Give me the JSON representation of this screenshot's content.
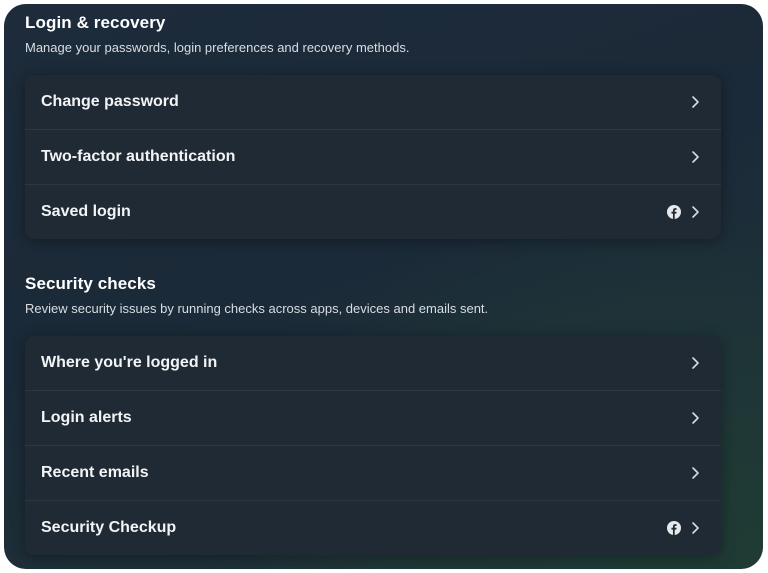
{
  "login_recovery": {
    "title": "Login & recovery",
    "description": "Manage your passwords, login preferences and recovery methods.",
    "items": [
      {
        "label": "Change password",
        "icon": "chevron-right-icon"
      },
      {
        "label": "Two-factor authentication",
        "icon": "chevron-right-icon"
      },
      {
        "label": "Saved login",
        "badge_icon": "facebook-icon",
        "icon": "chevron-right-icon"
      }
    ]
  },
  "security_checks": {
    "title": "Security checks",
    "description": "Review security issues by running checks across apps, devices and emails sent.",
    "items": [
      {
        "label": "Where you're logged in",
        "icon": "chevron-right-icon"
      },
      {
        "label": "Login alerts",
        "icon": "chevron-right-icon"
      },
      {
        "label": "Recent emails",
        "icon": "chevron-right-icon"
      },
      {
        "label": "Security Checkup",
        "badge_icon": "facebook-icon",
        "icon": "chevron-right-icon"
      }
    ]
  },
  "colors": {
    "background": "#1d2b3a",
    "card": "#1f2a34",
    "text": "#ffffff"
  }
}
